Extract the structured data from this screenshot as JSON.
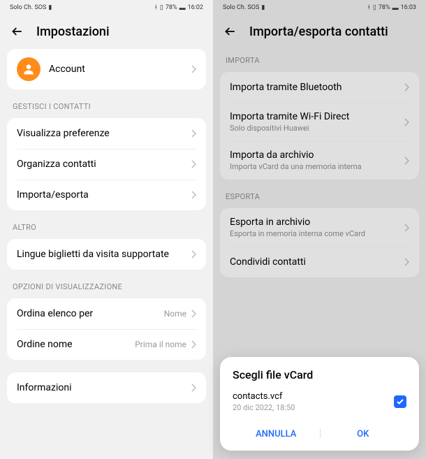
{
  "left": {
    "status": {
      "carrier": "Solo Ch. SOS",
      "battery": "78%",
      "time": "16:02"
    },
    "title": "Impostazioni",
    "account_label": "Account",
    "sections": {
      "manage": {
        "title": "GESTISCI I CONTATTI",
        "prefs": "Visualizza preferenze",
        "organize": "Organizza contatti",
        "importexport": "Importa/esporta"
      },
      "other": {
        "title": "ALTRO",
        "langs": "Lingue biglietti da visita supportate"
      },
      "display": {
        "title": "OPZIONI DI VISUALIZZAZIONE",
        "sort_label": "Ordina elenco per",
        "sort_value": "Nome",
        "order_label": "Ordine nome",
        "order_value": "Prima il nome"
      },
      "info": "Informazioni"
    }
  },
  "right": {
    "status": {
      "carrier": "Solo Ch. SOS",
      "battery": "78%",
      "time": "16:03"
    },
    "title": "Importa/esporta contatti",
    "import": {
      "title": "IMPORTA",
      "bluetooth": "Importa tramite Bluetooth",
      "wifi": "Importa tramite Wi-Fi Direct",
      "wifi_sub": "Solo dispositivi Huawei",
      "archive": "Importa da archivio",
      "archive_sub": "Importa vCard da una memoria interna"
    },
    "export": {
      "title": "ESPORTA",
      "archive": "Esporta in archivio",
      "archive_sub": "Esporta in memoria interna come vCard",
      "share": "Condividi contatti"
    },
    "dialog": {
      "title": "Scegli file vCard",
      "file_name": "contacts.vcf",
      "file_date": "20 dic 2022, 18:50",
      "cancel": "ANNULLA",
      "ok": "OK"
    }
  }
}
